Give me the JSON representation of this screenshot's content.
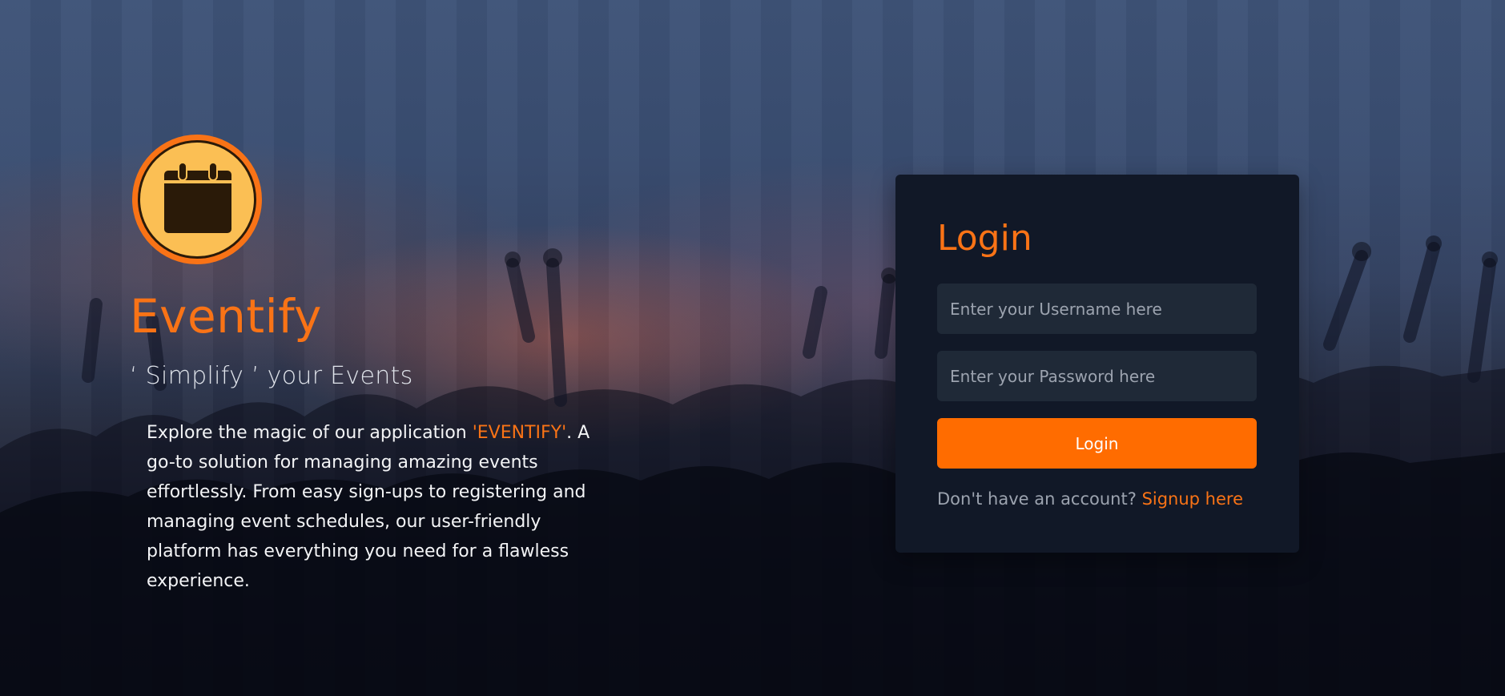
{
  "brand": {
    "logo_icon": "calendar-icon",
    "title": "Eventify",
    "tagline": "‘ Simplify ’ your Events",
    "description": {
      "before": "Explore the magic of our application ",
      "highlight": "'EVENTIFY'",
      "after": ". A go-to solution for managing amazing events effortlessly. From easy sign-ups to registering and managing event schedules, our user-friendly platform has everything you need for a flawless experience."
    }
  },
  "login": {
    "heading": "Login",
    "username_placeholder": "Enter your Username here",
    "password_placeholder": "Enter your Password here",
    "button_label": "Login",
    "signup_prompt": "Don't have an account?",
    "signup_link": "Signup here"
  },
  "colors": {
    "accent": "#f97316",
    "button": "#ff6c00",
    "card": "#111827",
    "input": "#1f2937",
    "logo_fill": "#fbbf54",
    "logo_ring": "#f97316",
    "logo_icon": "#2a1a08"
  }
}
